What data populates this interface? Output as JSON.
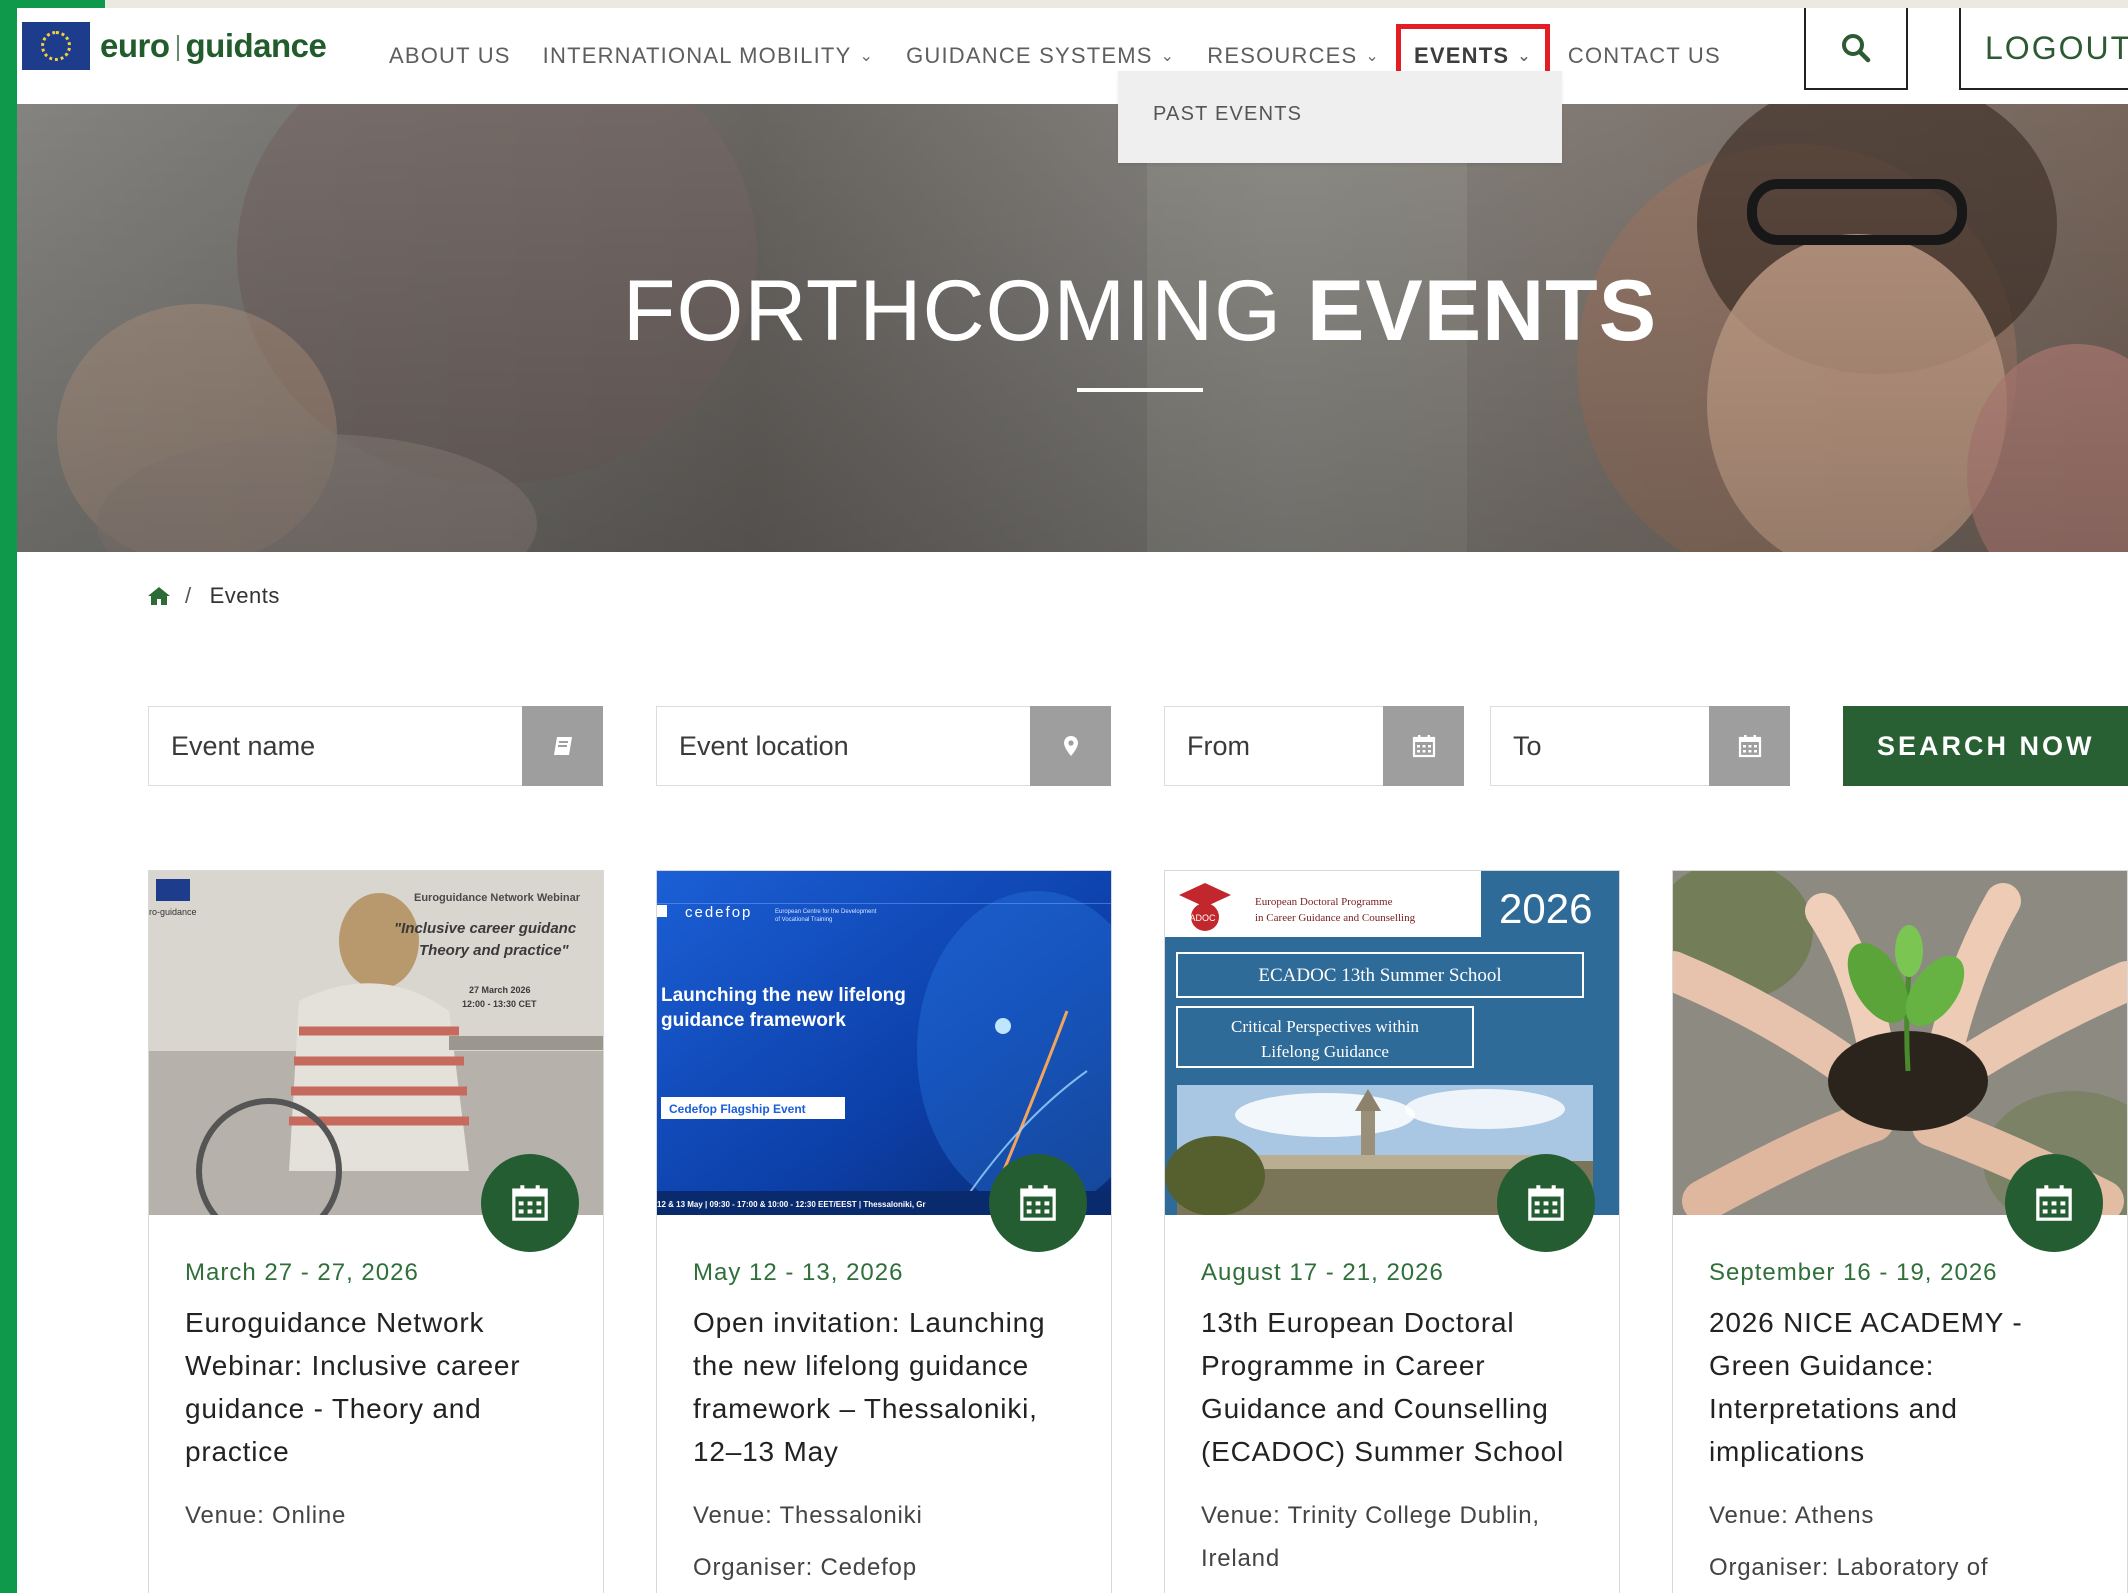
{
  "header": {
    "logo_euro": "euro",
    "logo_guidance": "guidance",
    "nav": [
      {
        "label": "ABOUT US",
        "dropdown": false
      },
      {
        "label": "INTERNATIONAL MOBILITY",
        "dropdown": true
      },
      {
        "label": "GUIDANCE SYSTEMS",
        "dropdown": true
      },
      {
        "label": "RESOURCES",
        "dropdown": true
      },
      {
        "label": "EVENTS",
        "dropdown": true
      },
      {
        "label": "CONTACT US",
        "dropdown": false
      }
    ],
    "active_item": "EVENTS",
    "events_menu": [
      "PAST EVENTS"
    ],
    "logout_label": "LOGOUT"
  },
  "hero": {
    "title_light": "FORTHCOMING",
    "title_bold": "EVENTS"
  },
  "breadcrumb": {
    "separator": "/",
    "current": "Events"
  },
  "filters": {
    "event_name_placeholder": "Event name",
    "event_location_placeholder": "Event location",
    "from_placeholder": "From",
    "to_placeholder": "To",
    "search_label": "SEARCH NOW"
  },
  "cards": [
    {
      "date": "March 27 - 27, 2026",
      "title": "Euroguidance Network Webinar: Inclusive career guidance - Theory and practice",
      "venue_label": "Venue:",
      "venue": "Online",
      "organiser_label": "",
      "organiser": "",
      "image": {
        "caption_small": "Euroguidance Network Webinar",
        "caption_quote": "\"Inclusive career guidance Theory and practice\"",
        "caption_date": "27 March 2026",
        "caption_time": "12:00 - 13:30 CET",
        "logo_text": "ro-guidance"
      }
    },
    {
      "date": "May 12 - 13, 2026",
      "title": "Open invitation: Launching the new lifelong guidance framework – Thessaloniki, 12–13 May",
      "venue_label": "Venue:",
      "venue": "Thessaloniki",
      "organiser_label": "Organiser:",
      "organiser": "Cedefop",
      "image": {
        "brand": "cedefop",
        "brand_sub": "European Centre for the Development of Vocational Training",
        "headline": "Launching the new lifelong guidance framework",
        "pill": "Cedefop Flagship Event",
        "bottom": "12 & 13 May | 09:30 - 17:00 & 10:00 - 12:30 EET/EEST | Thessaloniki, Gr"
      }
    },
    {
      "date": "August 17 - 21, 2026",
      "title": "13th European Doctoral Programme in Career Guidance and Counselling (ECADOC) Summer School",
      "venue_label": "Venue:",
      "venue": "Trinity College Dublin, Ireland",
      "organiser_label": "",
      "organiser": "",
      "image": {
        "year": "2026",
        "org_line1": "European Doctoral Programme",
        "org_line2": "in Career Guidance and Counselling",
        "logo": "ECADOC",
        "box1": "ECADOC 13th Summer School",
        "box2_line1": "Critical Perspectives within",
        "box2_line2": "Lifelong Guidance"
      }
    },
    {
      "date": "September 16 - 19, 2026",
      "title": "2026 NICE ACADEMY - Green Guidance: Interpretations and implications",
      "venue_label": "Venue:",
      "venue": "Athens",
      "organiser_label": "Organiser:",
      "organiser": "Laboratory of",
      "image": {}
    }
  ],
  "colors": {
    "brand_green": "#285f33",
    "accent_green": "#0e9a4a",
    "highlight_red": "#e31d24",
    "icon_button_grey": "#9e9e9e"
  }
}
